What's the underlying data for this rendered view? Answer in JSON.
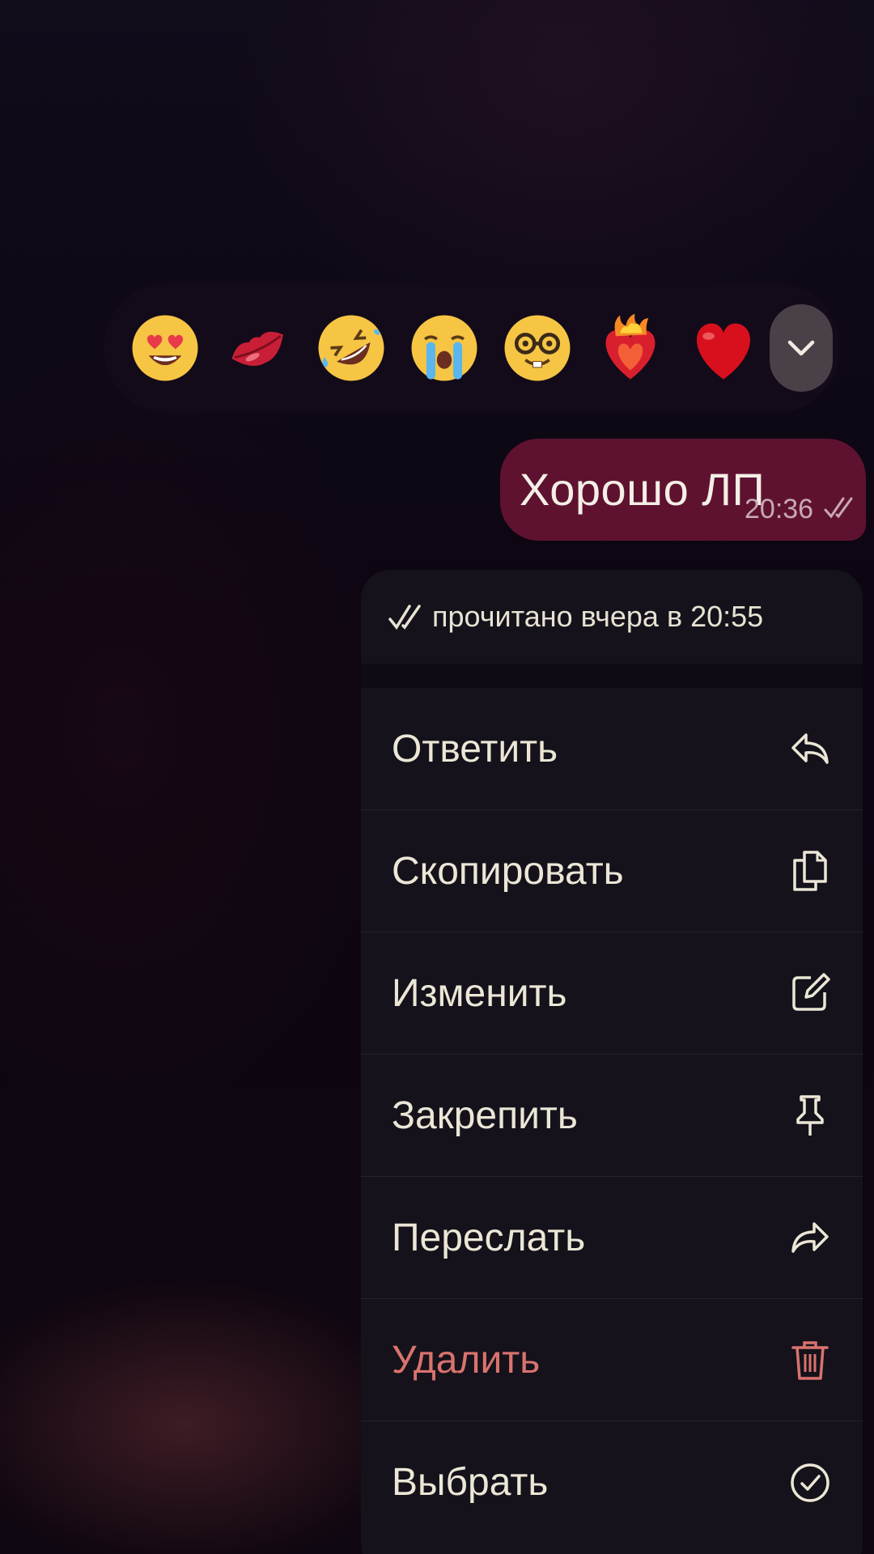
{
  "reactions": {
    "items": [
      {
        "icon": "heart-eyes-emoji"
      },
      {
        "icon": "kiss-lips-emoji"
      },
      {
        "icon": "rolling-laughing-emoji"
      },
      {
        "icon": "crying-emoji"
      },
      {
        "icon": "nerd-face-emoji"
      },
      {
        "icon": "heart-on-fire-emoji"
      },
      {
        "icon": "red-heart-emoji"
      }
    ],
    "expand_icon": "chevron-down-icon"
  },
  "message": {
    "text": "Хорошо ЛП",
    "time": "20:36",
    "status_icon": "double-check-icon",
    "bubble_color": "#5f1230"
  },
  "menu": {
    "read_status": "прочитано вчера в 20:55",
    "items": [
      {
        "label": "Ответить",
        "icon": "reply-icon"
      },
      {
        "label": "Скопировать",
        "icon": "copy-icon"
      },
      {
        "label": "Изменить",
        "icon": "edit-icon"
      },
      {
        "label": "Закрепить",
        "icon": "pin-icon"
      },
      {
        "label": "Переслать",
        "icon": "forward-icon"
      },
      {
        "label": "Удалить",
        "icon": "trash-icon",
        "color": "#d9736d"
      },
      {
        "label": "Выбрать",
        "icon": "select-check-icon"
      }
    ]
  }
}
